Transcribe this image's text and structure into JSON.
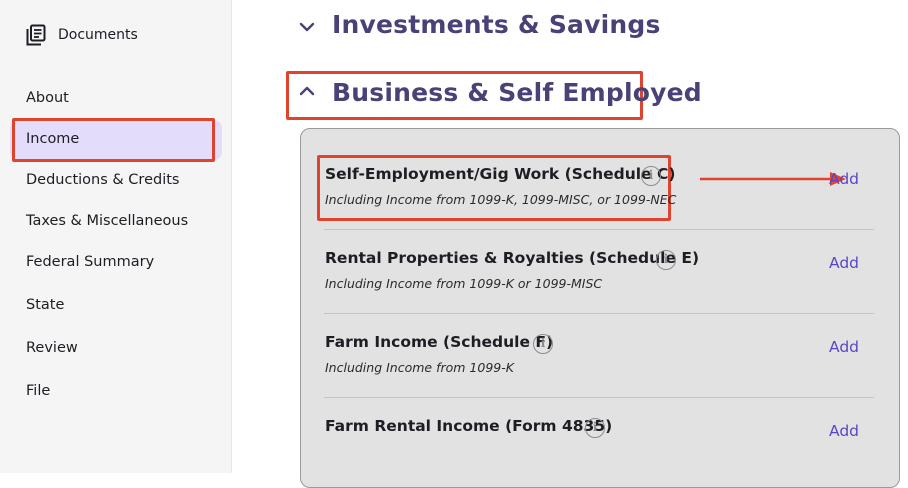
{
  "sidebar": {
    "documents_label": "Documents",
    "items": [
      {
        "label": "About"
      },
      {
        "label": "Income"
      },
      {
        "label": "Deductions & Credits"
      },
      {
        "label": "Taxes & Miscellaneous"
      },
      {
        "label": "Federal Summary"
      },
      {
        "label": "State"
      },
      {
        "label": "Review"
      },
      {
        "label": "File"
      }
    ],
    "active_item": "Income"
  },
  "main": {
    "sections": [
      {
        "title": "Investments & Savings",
        "expanded": false
      },
      {
        "title": "Business & Self Employed",
        "expanded": true
      }
    ],
    "rows": [
      {
        "title": "Self-Employment/Gig Work (Schedule C)",
        "subtitle": "Including Income from 1099-K, 1099-MISC, or 1099-NEC",
        "action": "Add"
      },
      {
        "title": "Rental Properties & Royalties (Schedule E)",
        "subtitle": "Including Income from 1099-K or 1099-MISC",
        "action": "Add"
      },
      {
        "title": "Farm Income (Schedule F)",
        "subtitle": "Including Income from 1099-K",
        "action": "Add"
      },
      {
        "title": "Farm Rental Income (Form 4835)",
        "subtitle": "",
        "action": "Add"
      }
    ]
  },
  "colors": {
    "accent": "#5a46c8",
    "heading": "#4b4177",
    "highlight": "#e0442e",
    "active_bg": "#e3ddfb"
  },
  "icons": {
    "documents": "documents-icon",
    "info": "info-icon",
    "chevron_down": "chevron-down-icon",
    "chevron_up": "chevron-up-icon"
  }
}
